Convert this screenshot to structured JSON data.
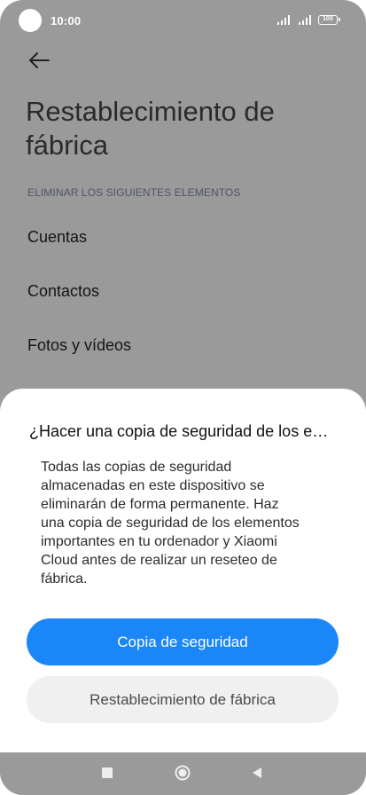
{
  "status_bar": {
    "time": "10:00",
    "battery": "100",
    "icons": [
      "signal-icon",
      "signal-icon",
      "battery-icon"
    ]
  },
  "header": {
    "back_icon": "arrow-left-icon"
  },
  "page": {
    "title": "Restablecimiento de fábrica",
    "section_header": "ELIMINAR LOS SIGUIENTES ELEMENTOS",
    "items": [
      "Cuentas",
      "Contactos",
      "Fotos y vídeos"
    ]
  },
  "dialog": {
    "title": "¿Hacer una copia de seguridad de los e…",
    "message": "Todas las copias de seguridad\nalmacenadas en este dispositivo se\neliminarán de forma permanente. Haz\nuna copia de seguridad de los elementos\nimportantes en tu ordenador y Xiaomi\nCloud antes de realizar un reseteo de\nfábrica.",
    "primary_button": "Copia de seguridad",
    "secondary_button": "Restablecimiento de fábrica"
  },
  "navigation": {
    "icons": [
      "recents-square-icon",
      "home-circle-icon",
      "back-triangle-icon"
    ]
  },
  "colors": {
    "overlay": "#9a9a9a",
    "primary": "#1a86f7",
    "secondary_button": "#f0f0f0",
    "sheet": "#ffffff"
  }
}
